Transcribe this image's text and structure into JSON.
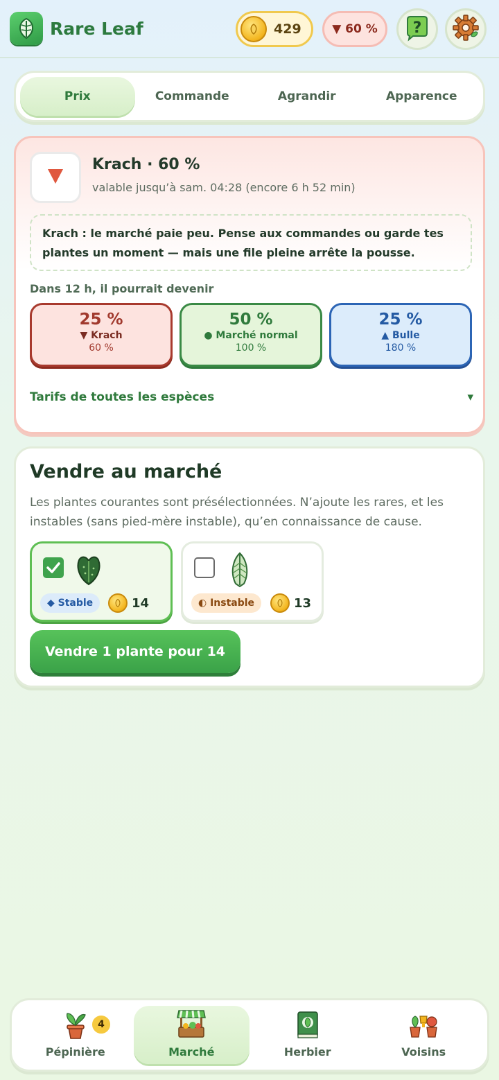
{
  "header": {
    "app_name": "Rare Leaf",
    "coins": "429",
    "market_indicator": "▼ 60 %",
    "logo_icon": "leaf-logo-icon",
    "help_icon": "question-icon",
    "settings_icon": "gear-icon"
  },
  "tabs": [
    {
      "label": "Prix",
      "active": true
    },
    {
      "label": "Commande"
    },
    {
      "label": "Agrandir"
    },
    {
      "label": "Apparence"
    }
  ],
  "market_state": {
    "title": "Krach · 60 %",
    "validity": "valable jusqu’à sam. 04:28 (encore 6 h 52 min)",
    "note": "Krach : le marché paie peu. Pense aux commandes ou garde tes plantes un moment — mais une file pleine arrête la pousse.",
    "forecast_label": "Dans 12 h, il pourrait devenir",
    "forecast": [
      {
        "chance": "25 %",
        "label": "▼ Krach",
        "value": "60 %"
      },
      {
        "chance": "50 %",
        "label": "● Marché normal",
        "value": "100 %"
      },
      {
        "chance": "25 %",
        "label": "▲ Bulle",
        "value": "180 %"
      }
    ],
    "all_rates_label": "Tarifs de toutes les espèces",
    "expand_glyph": "▾"
  },
  "sell": {
    "title": "Vendre au marché",
    "description": "Les plantes courantes sont présélectionnées. N’ajoute les rares, et les instables (sans pied-mère instable), qu’en connaissance de cause.",
    "plants": [
      {
        "checked": true,
        "badge": "◆ Stable",
        "price": "14",
        "icon": "heart-leaf-icon"
      },
      {
        "checked": false,
        "badge": "◐ Instable",
        "price": "13",
        "icon": "arrow-leaf-icon"
      }
    ],
    "button_label": "Vendre 1 plante pour 14"
  },
  "nav": [
    {
      "label": "Pépinière",
      "badge": "4",
      "icon": "potted-plant-icon"
    },
    {
      "label": "Marché",
      "active": true,
      "icon": "market-stall-icon"
    },
    {
      "label": "Herbier",
      "icon": "book-icon"
    },
    {
      "label": "Voisins",
      "icon": "neighbors-plants-icon"
    }
  ],
  "colors": {
    "brand_green": "#2f7a3c",
    "crash_red": "#a1392d",
    "bubble_blue": "#245aa3",
    "coin_gold": "#f3b51e"
  }
}
